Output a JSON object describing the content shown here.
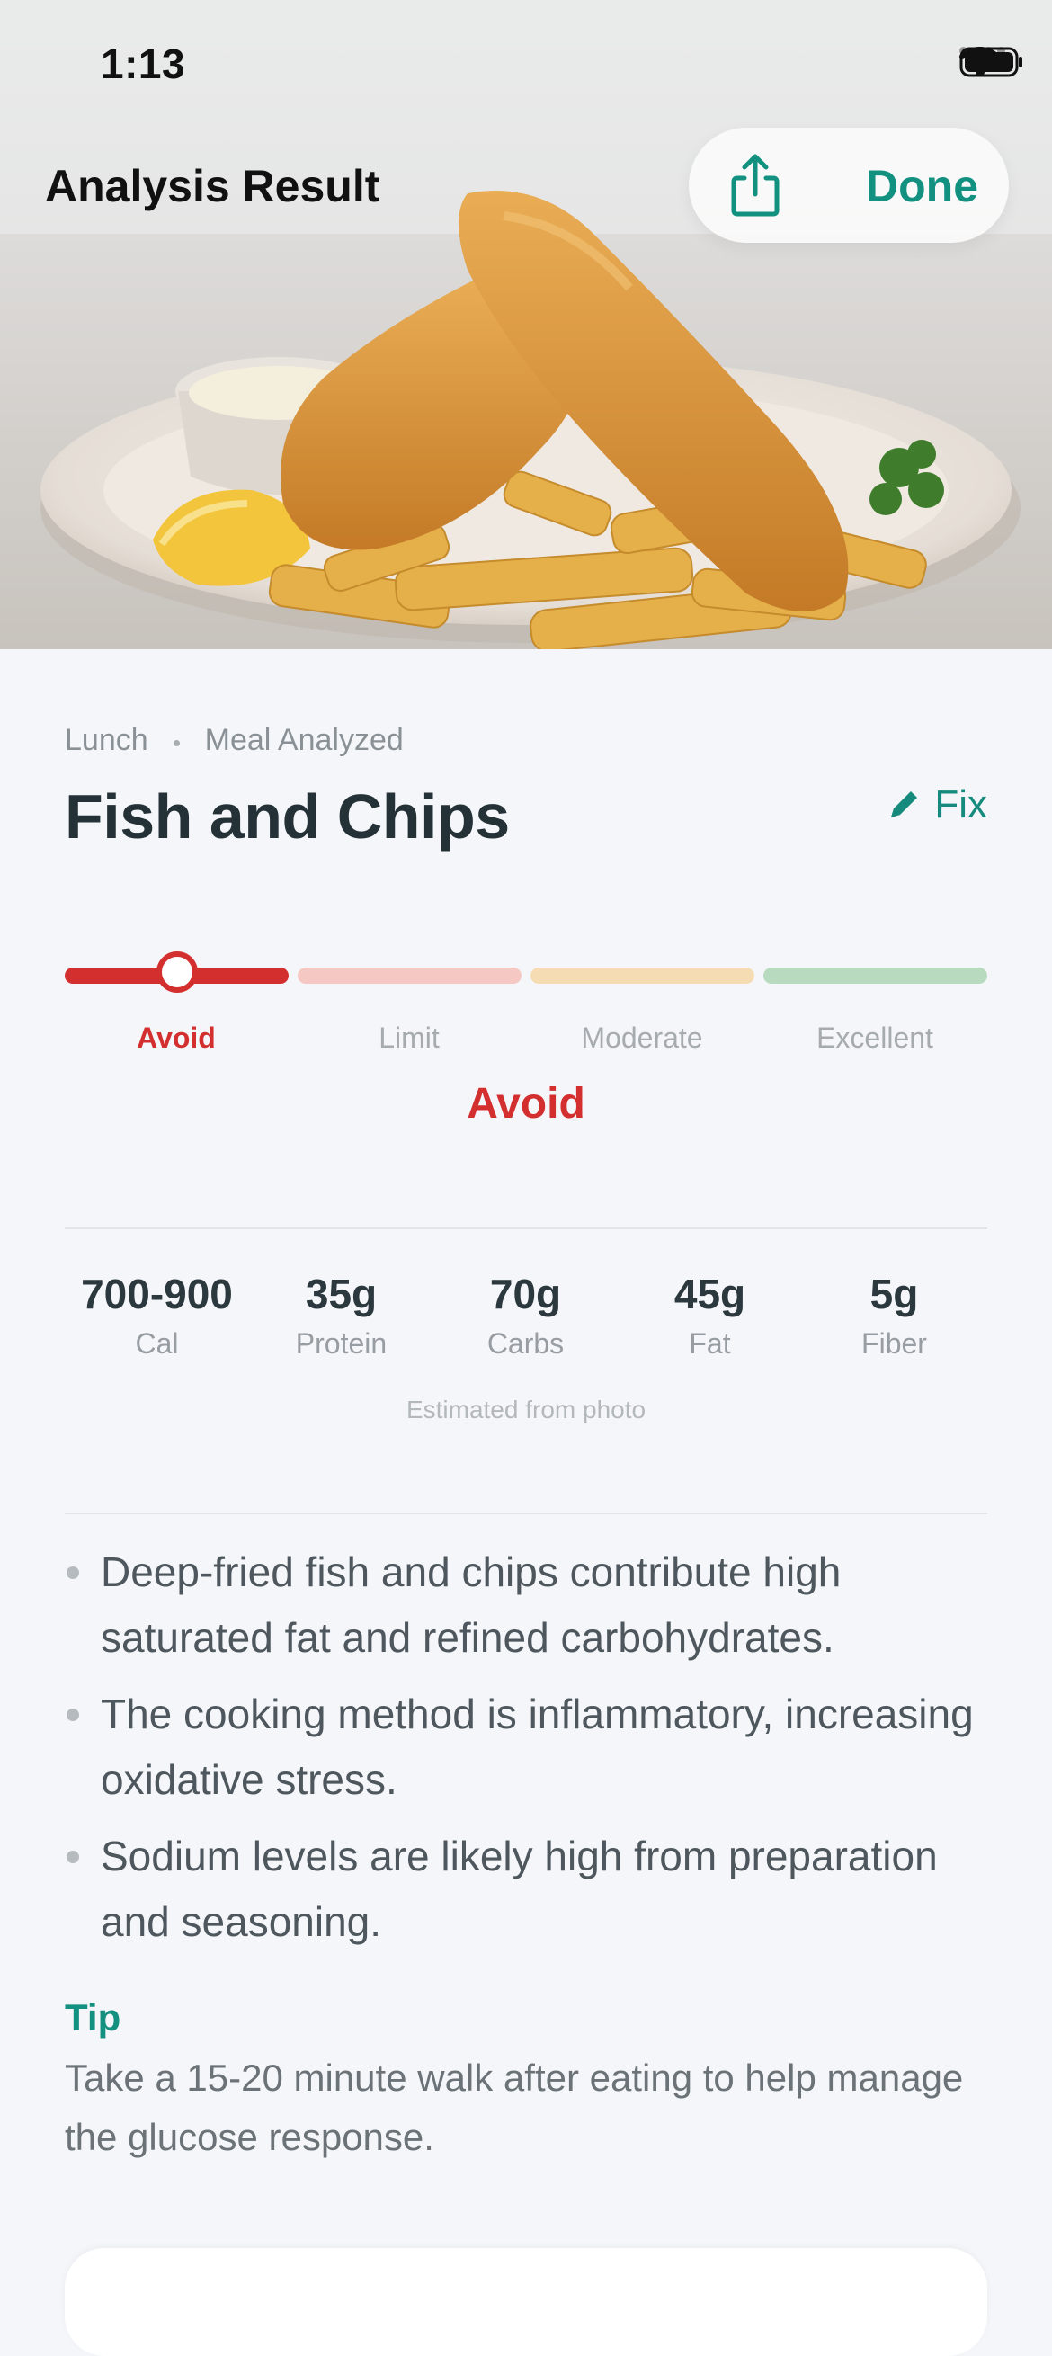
{
  "status": {
    "time": "1:13"
  },
  "header": {
    "title": "Analysis Result",
    "done_label": "Done"
  },
  "meal": {
    "meal_type": "Lunch",
    "status_text": "Meal Analyzed",
    "name": "Fish and Chips",
    "fix_label": "Fix"
  },
  "rating": {
    "levels": [
      "Avoid",
      "Limit",
      "Moderate",
      "Excellent"
    ],
    "selected_index": 0,
    "verdict": "Avoid",
    "colors": {
      "avoid": "#d32f2f",
      "limit": "#f6c8c3",
      "moderate": "#f6dcb3",
      "excellent": "#b8dbbf"
    }
  },
  "nutrition": {
    "items": [
      {
        "value": "700-900",
        "label": "Cal"
      },
      {
        "value": "35g",
        "label": "Protein"
      },
      {
        "value": "70g",
        "label": "Carbs"
      },
      {
        "value": "45g",
        "label": "Fat"
      },
      {
        "value": "5g",
        "label": "Fiber"
      }
    ],
    "note": "Estimated from photo"
  },
  "insights": [
    "Deep-fried fish and chips contribute high saturated fat and refined carbohydrates.",
    "The cooking method is inflammatory, increasing oxidative stress.",
    "Sodium levels are likely high from preparation and seasoning."
  ],
  "tip": {
    "title": "Tip",
    "text": "Take a 15-20 minute walk after eating to help manage the glucose response."
  },
  "theme": {
    "accent": "#129080",
    "danger": "#d32f2f",
    "background": "#f5f6f9"
  },
  "icons": {
    "share": "share-icon",
    "edit": "pencil-icon",
    "wifi": "wifi-icon",
    "battery": "battery-icon"
  }
}
